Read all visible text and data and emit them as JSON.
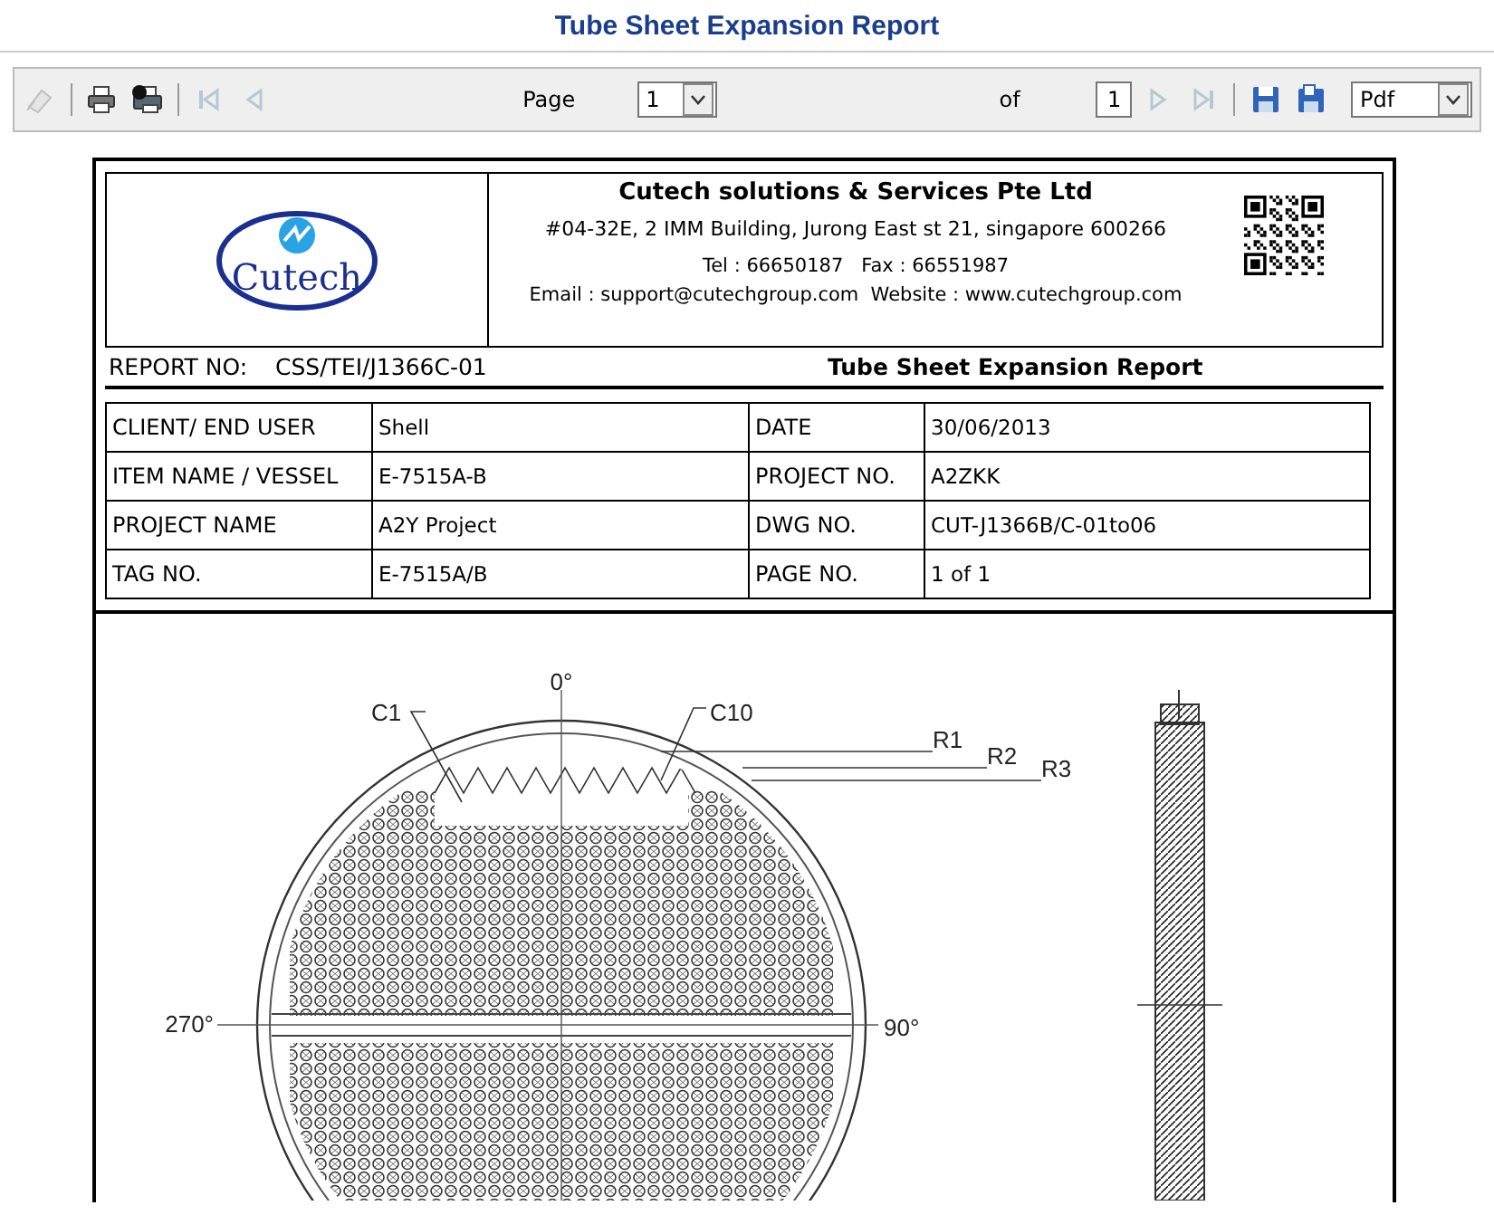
{
  "window": {
    "title": "Tube Sheet Expansion Report"
  },
  "toolbar": {
    "left_buttons": [
      {
        "kind": "clear",
        "disabled": true
      },
      {
        "kind": "separator"
      },
      {
        "kind": "print",
        "disabled": false
      },
      {
        "kind": "print-setup",
        "disabled": false
      },
      {
        "kind": "separator"
      },
      {
        "kind": "first",
        "disabled": true
      },
      {
        "kind": "prev",
        "disabled": true
      }
    ],
    "page_label": "Page",
    "page_select": "1",
    "of_label": "of",
    "page_count": "1",
    "right_buttons": [
      {
        "kind": "next",
        "disabled": true
      },
      {
        "kind": "last",
        "disabled": true
      },
      {
        "kind": "separator"
      },
      {
        "kind": "save",
        "disabled": false
      },
      {
        "kind": "save-as",
        "disabled": false
      }
    ],
    "format_select": "Pdf"
  },
  "report": {
    "logo_text": "Cutech",
    "company": "Cutech solutions & Services Pte Ltd",
    "address": "#04-32E, 2 IMM Building, Jurong East st 21, singapore 600266",
    "phone_fax": "Tel : 66650187   Fax : 66551987",
    "email_web": "Email : support@cutechgroup.com  Website : www.cutechgroup.com",
    "report_no_label": "REPORT NO:",
    "report_no": "CSS/TEI/J1366C-01",
    "report_title": "Tube Sheet Expansion Report",
    "info_rows": [
      {
        "label_1": "CLIENT/ END USER",
        "value_1": "Shell",
        "label_2": "DATE",
        "value_2": "30/06/2013"
      },
      {
        "label_1": "ITEM NAME / VESSEL",
        "value_1": "E-7515A-B",
        "label_2": "PROJECT NO.",
        "value_2": "A2ZKK"
      },
      {
        "label_1": "PROJECT NAME",
        "value_1": "A2Y Project",
        "label_2": "DWG NO.",
        "value_2": "CUT-J1366B/C-01to06"
      },
      {
        "label_1": "TAG NO.",
        "value_1": "E-7515A/B",
        "label_2": "PAGE NO.",
        "value_2": "1 of 1"
      }
    ],
    "drawing_labels": [
      {
        "kind": "row-c1",
        "text": "C1"
      },
      {
        "kind": "top",
        "text": "0°"
      },
      {
        "kind": "row-c10",
        "text": "C10"
      },
      {
        "kind": "r1",
        "text": "R1"
      },
      {
        "kind": "r2",
        "text": "R2"
      },
      {
        "kind": "r3",
        "text": "R3"
      },
      {
        "kind": "left",
        "text": "270°"
      },
      {
        "kind": "right",
        "text": "90°"
      }
    ]
  }
}
